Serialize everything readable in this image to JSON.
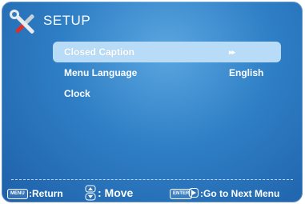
{
  "header": {
    "title": "SETUP",
    "icon": "tools-icon"
  },
  "menu": {
    "items": [
      {
        "label": "Closed Caption",
        "value": "▸▸",
        "selected": true
      },
      {
        "label": "Menu Language",
        "value": "English",
        "selected": false
      },
      {
        "label": "Clock",
        "value": "",
        "selected": false
      }
    ]
  },
  "footer": {
    "menu_key": "MENU",
    "return_label": ":Return",
    "move_label": ": Move",
    "enter_key": "ENTER",
    "next_label": ":Go to Next Menu"
  },
  "colors": {
    "background": "#2f7fc6",
    "highlight": "#b8dcf7",
    "text": "#ffffff"
  }
}
